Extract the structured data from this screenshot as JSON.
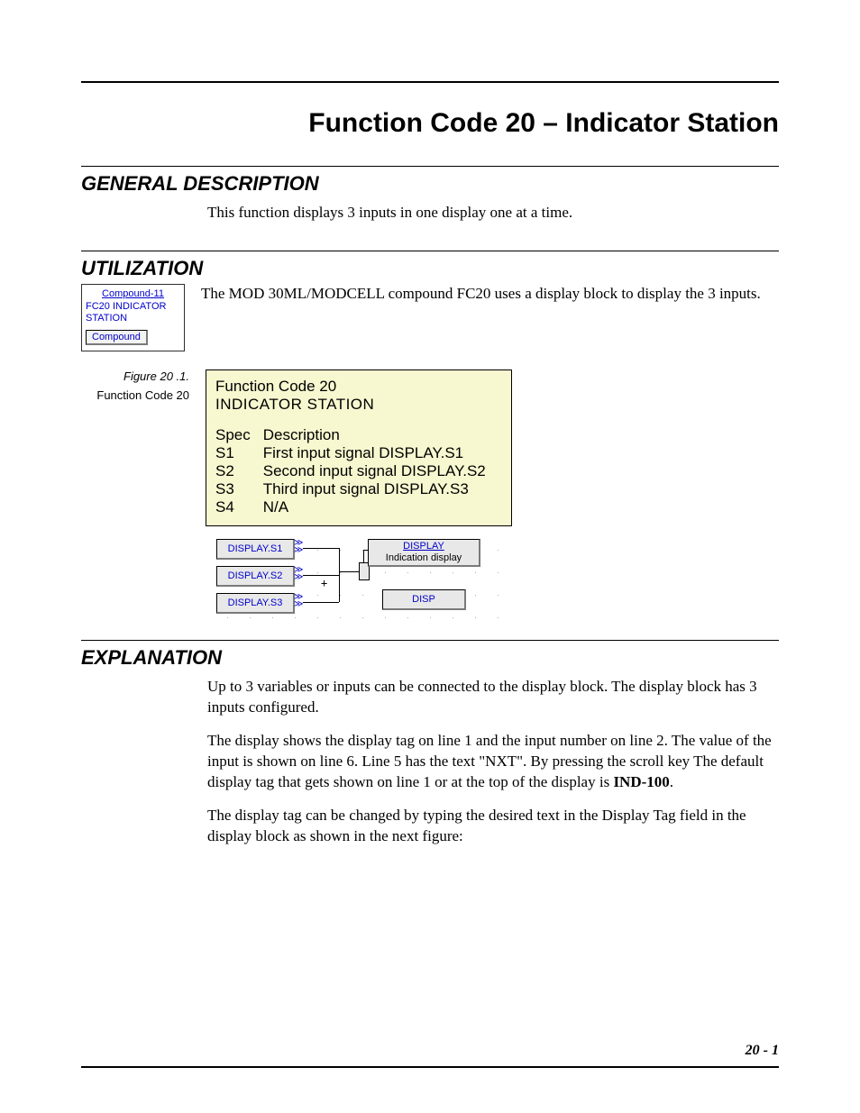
{
  "title": "Function Code 20 – Indicator Station",
  "sections": {
    "general": {
      "heading": "GENERAL DESCRIPTION",
      "body": "This function displays 3 inputs in one display one at a time."
    },
    "utilization": {
      "heading": "UTILIZATION",
      "body": "The MOD 30ML/MODCELL compound FC20 uses a display block to display the 3 inputs.",
      "widget": {
        "title": "Compound-11",
        "sub1": "FC20 INDICATOR",
        "sub2": "STATION",
        "tab": "Compound"
      }
    },
    "figure": {
      "cap_title": "Figure 20 .1.",
      "cap_sub": "Function Code 20",
      "spec": {
        "line1": "Function Code 20",
        "line2": "INDICATOR STATION",
        "col_spec": "Spec",
        "col_desc": "Description",
        "rows": [
          {
            "s": "S1",
            "d": "First input signal DISPLAY.S1"
          },
          {
            "s": "S2",
            "d": "Second input signal DISPLAY.S2"
          },
          {
            "s": "S3",
            "d": "Third input signal DISPLAY.S3"
          },
          {
            "s": "S4",
            "d": "N/A"
          }
        ]
      },
      "diagram": {
        "ports": [
          "DISPLAY.S1",
          "DISPLAY.S2",
          "DISPLAY.S3"
        ],
        "block_title": "DISPLAY",
        "block_sub": "Indication display",
        "tab": "DISP"
      }
    },
    "explanation": {
      "heading": "EXPLANATION",
      "p1": "Up to 3 variables or inputs can be connected to the display block. The display block has 3 inputs configured.",
      "p2a": "The display shows the display tag on line 1 and the input number on line 2. The value of the input is shown on line 6. Line 5 has the text \"NXT\". By pressing the scroll key The default display tag that gets shown on line 1 or at the top of the display is ",
      "p2b": "IND-100",
      "p2c": ".",
      "p3": "The display tag can be changed by typing the desired text in the Display Tag field in the display block as shown in the next figure:"
    }
  },
  "footer": "20 - 1"
}
